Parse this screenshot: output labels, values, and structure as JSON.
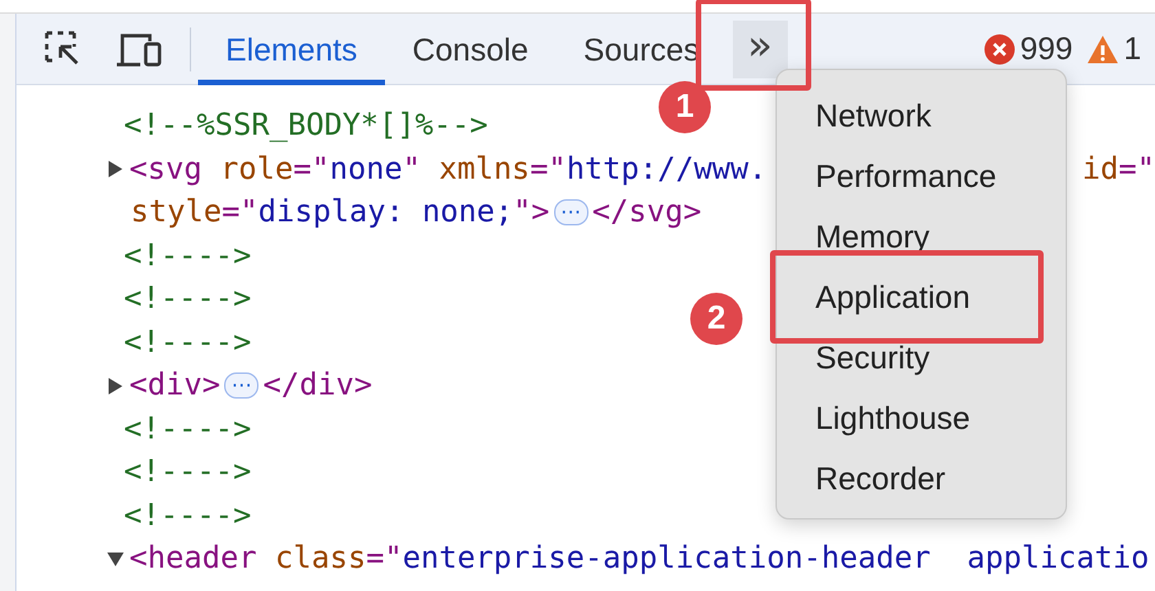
{
  "toolbar": {
    "tabs": [
      {
        "label": "Elements",
        "selected": true
      },
      {
        "label": "Console",
        "selected": false
      },
      {
        "label": "Sources",
        "selected": false
      }
    ],
    "more_button": {
      "text": "»",
      "highlighted": true
    },
    "errors": "999",
    "warnings": "1"
  },
  "code_lines": [
    {
      "kind": "comment",
      "parts": [
        {
          "kind": "code",
          "tokens": [
            {
              "kind": "comment",
              "text": "<!--%SSR_BODY*[]%-->"
            }
          ]
        }
      ]
    },
    {
      "kind": "element",
      "expanded": false,
      "parts": [
        {
          "kind": "code",
          "tokens": [
            {
              "kind": "tag",
              "text": "<svg "
            },
            {
              "kind": "attr",
              "text": "role"
            },
            {
              "kind": "tag",
              "text": "=\""
            },
            {
              "kind": "value",
              "text": "none"
            },
            {
              "kind": "tag",
              "text": "\" "
            },
            {
              "kind": "attr",
              "text": "xmlns"
            },
            {
              "kind": "tag",
              "text": "=\""
            },
            {
              "kind": "value",
              "text": "http://www."
            }
          ]
        },
        {
          "kind": "tail",
          "tokens": [
            {
              "kind": "attr",
              "text": "id"
            },
            {
              "kind": "tag",
              "text": "=\""
            }
          ]
        }
      ]
    },
    {
      "kind": "continuation",
      "parts": [
        {
          "kind": "code",
          "tokens": [
            {
              "kind": "attr",
              "text": "style"
            },
            {
              "kind": "tag",
              "text": "=\""
            },
            {
              "kind": "value",
              "text": "display: none;"
            },
            {
              "kind": "tag",
              "text": "\">"
            }
          ]
        },
        {
          "kind": "ellipsis",
          "text": "⋯"
        },
        {
          "kind": "code",
          "tokens": [
            {
              "kind": "tag",
              "text": "</svg>"
            }
          ]
        }
      ]
    },
    {
      "kind": "comment",
      "parts": [
        {
          "kind": "code",
          "tokens": [
            {
              "kind": "comment",
              "text": "<!---->"
            }
          ]
        }
      ]
    },
    {
      "kind": "comment",
      "parts": [
        {
          "kind": "code",
          "tokens": [
            {
              "kind": "comment",
              "text": "<!---->"
            }
          ]
        }
      ]
    },
    {
      "kind": "comment",
      "parts": [
        {
          "kind": "code",
          "tokens": [
            {
              "kind": "comment",
              "text": "<!---->"
            }
          ]
        }
      ]
    },
    {
      "kind": "element",
      "expanded": false,
      "parts": [
        {
          "kind": "code",
          "tokens": [
            {
              "kind": "tag",
              "text": "<div>"
            }
          ]
        },
        {
          "kind": "ellipsis",
          "text": "⋯"
        },
        {
          "kind": "code",
          "tokens": [
            {
              "kind": "tag",
              "text": "</div>"
            }
          ]
        }
      ]
    },
    {
      "kind": "comment",
      "parts": [
        {
          "kind": "code",
          "tokens": [
            {
              "kind": "comment",
              "text": "<!---->"
            }
          ]
        }
      ]
    },
    {
      "kind": "comment",
      "parts": [
        {
          "kind": "code",
          "tokens": [
            {
              "kind": "comment",
              "text": "<!---->"
            }
          ]
        }
      ]
    },
    {
      "kind": "comment",
      "parts": [
        {
          "kind": "code",
          "tokens": [
            {
              "kind": "comment",
              "text": "<!---->"
            }
          ]
        }
      ]
    },
    {
      "kind": "element",
      "expanded": true,
      "parts": [
        {
          "kind": "code",
          "tokens": [
            {
              "kind": "tag",
              "text": "<header "
            },
            {
              "kind": "attr",
              "text": "class"
            },
            {
              "kind": "tag",
              "text": "=\""
            },
            {
              "kind": "value",
              "text": "enterprise-application-header  applicatio"
            }
          ]
        }
      ]
    }
  ],
  "menu": {
    "items": [
      {
        "label": "Network",
        "highlighted": false
      },
      {
        "label": "Performance",
        "highlighted": false
      },
      {
        "label": "Memory",
        "highlighted": false
      },
      {
        "label": "Application",
        "highlighted": true
      },
      {
        "label": "Security",
        "highlighted": false
      },
      {
        "label": "Lighthouse",
        "highlighted": false
      },
      {
        "label": "Recorder",
        "highlighted": false
      }
    ]
  },
  "step_markers": [
    {
      "number": "1"
    },
    {
      "number": "2"
    }
  ]
}
